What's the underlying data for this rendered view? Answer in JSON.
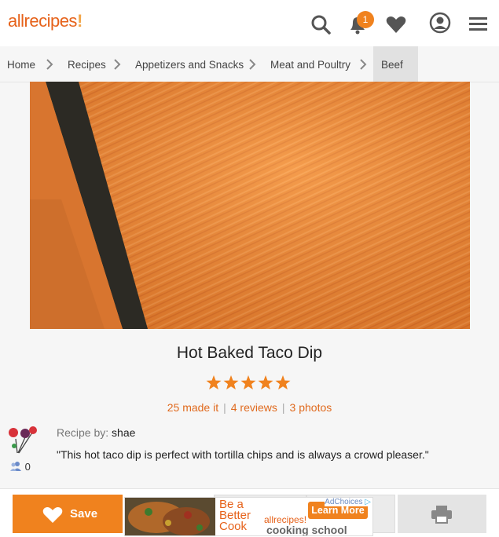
{
  "header": {
    "logo_text": "allrecipes",
    "logo_mark": "!",
    "notification_count": "1",
    "icons": [
      "search-icon",
      "bell-icon",
      "heart-icon",
      "user-icon",
      "menu-icon"
    ]
  },
  "breadcrumb": [
    "Home",
    "Recipes",
    "Appetizers and Snacks",
    "Meat and Poultry",
    "Beef"
  ],
  "recipe": {
    "title": "Hot Baked Taco Dip",
    "rating": 5,
    "made_it": "25 made it",
    "reviews": "4 reviews",
    "photos": "3 photos",
    "separator": "|",
    "byline_label": "Recipe by:",
    "author": "shae",
    "description": "\"This hot taco dip is perfect with tortilla chips and is always a crowd pleaser.\"",
    "followers": "0"
  },
  "actions": {
    "save_label": "Save"
  },
  "ad": {
    "adchoices": "AdChoices",
    "line1": "Be a",
    "line2": "Better",
    "line3": "Cook",
    "brand": "allrecipes",
    "brand_mark": "!",
    "learn_more": "Learn More",
    "cooking_school": "cooking school"
  },
  "colors": {
    "accent": "#f0821e",
    "logo": "#e6621a",
    "link": "#e06a1e"
  }
}
